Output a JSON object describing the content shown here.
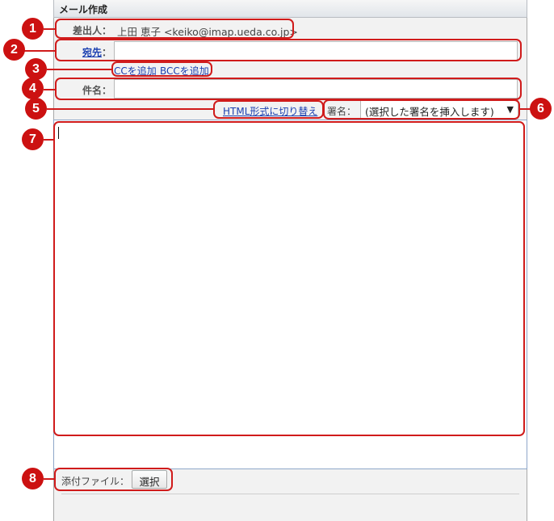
{
  "window": {
    "title": "メール作成"
  },
  "from": {
    "label": "差出人：",
    "value": "上田 恵子 <keiko@imap.ueda.co.jp>"
  },
  "to": {
    "label": "宛先",
    "separator": "：",
    "value": ""
  },
  "cc_links": {
    "add_cc": "CCを追加",
    "add_bcc": "BCCを追加"
  },
  "subject": {
    "label": "件名：",
    "value": ""
  },
  "format": {
    "switch_html": "HTML形式に切り替え"
  },
  "signature": {
    "label": "署名：",
    "selected": "(選択した署名を挿入します)",
    "arrow": "▼"
  },
  "body": {
    "value": ""
  },
  "attachment": {
    "label": "添付ファイル：",
    "button": "選択"
  },
  "callouts": [
    "1",
    "2",
    "3",
    "4",
    "5",
    "6",
    "7",
    "8"
  ],
  "colors": {
    "callout": "#cc1111",
    "link": "#1a3fb0",
    "body_border": "#8ea7c9"
  }
}
